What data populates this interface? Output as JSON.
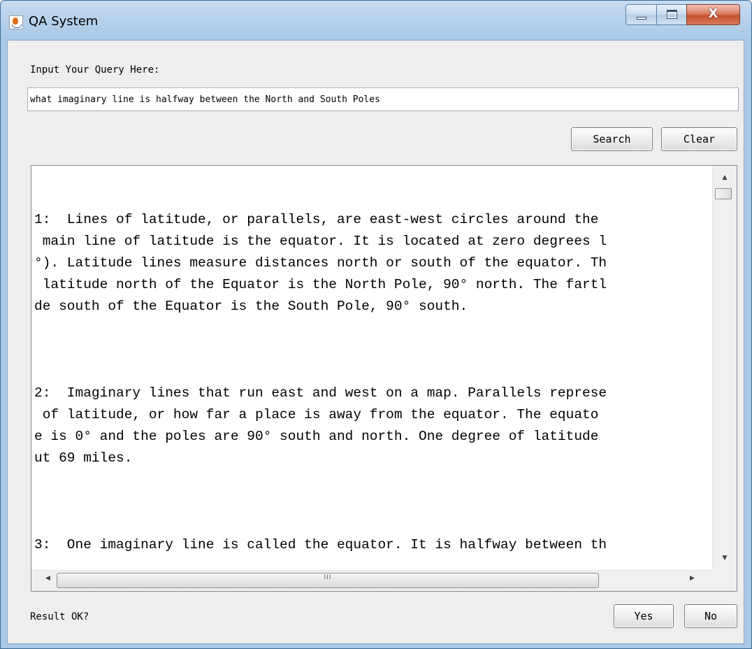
{
  "window": {
    "title": "QA System",
    "icon": "java-icon",
    "controls": {
      "minimize_icon": "minimize-icon",
      "maximize_icon": "maximize-icon",
      "close_glyph": "X"
    }
  },
  "query": {
    "label": "Input Your Query Here:",
    "value": "what imaginary line is halfway between the North and South Poles"
  },
  "buttons": {
    "search": "Search",
    "clear": "Clear",
    "yes": "Yes",
    "no": "No"
  },
  "results": {
    "text": "1:  Lines of latitude, or parallels, are east-west circles around the\n main line of latitude is the equator. It is located at zero degrees l\n°). Latitude lines measure distances north or south of the equator. Th\n latitude north of the Equator is the North Pole, 90° north. The fartl\nde south of the Equator is the South Pole, 90° south.\n\n\n\n2:  Imaginary lines that run east and west on a map. Parallels represe\n of latitude, or how far a place is away from the equator. The equato\ne is 0° and the poles are 90° south and north. One degree of latitude\nut 69 miles.\n\n\n\n3:  One imaginary line is called the equator. It is halfway between th",
    "scrollbar_grip": "III"
  },
  "feedback": {
    "label": "Result OK?"
  },
  "colors": {
    "titlebar": "#b5d0ea",
    "client_bg": "#eeeeee",
    "close_button": "#c4502d"
  }
}
